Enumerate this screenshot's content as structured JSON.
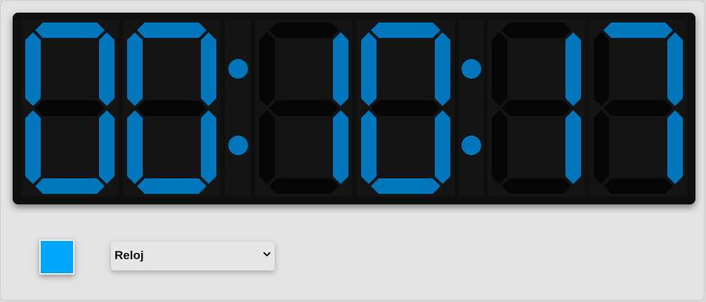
{
  "clock": {
    "digits": [
      "0",
      "0",
      "1",
      "0",
      "1",
      "7"
    ],
    "separators": [
      ":",
      ":"
    ],
    "on_color": "#0077bd",
    "off_color": "#060606",
    "cell_color": "#141414",
    "background_color": "#0f0f0f"
  },
  "controls": {
    "color_value": "#00a6ff",
    "mode": {
      "selected": "Reloj",
      "icon": "chevron-down-icon"
    }
  }
}
